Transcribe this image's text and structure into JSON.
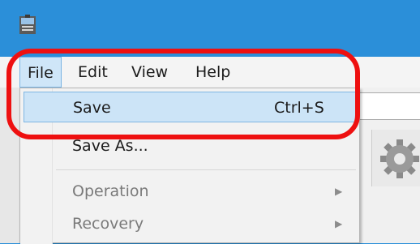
{
  "menubar": {
    "items": [
      {
        "label": "File"
      },
      {
        "label": "Edit"
      },
      {
        "label": "View"
      },
      {
        "label": "Help"
      }
    ]
  },
  "file_menu": {
    "items": [
      {
        "label": "Save",
        "shortcut": "Ctrl+S"
      },
      {
        "label": "Save As..."
      },
      {
        "label": "Operation"
      },
      {
        "label": "Recovery"
      }
    ]
  },
  "colors": {
    "titlebar": "#2b8fd9",
    "highlight_ring": "#ee1010",
    "menu_hover": "#cce4f7"
  },
  "icons": {
    "app": "app-icon",
    "gear": "gear-icon",
    "submenu": "chevron-right-icon"
  }
}
